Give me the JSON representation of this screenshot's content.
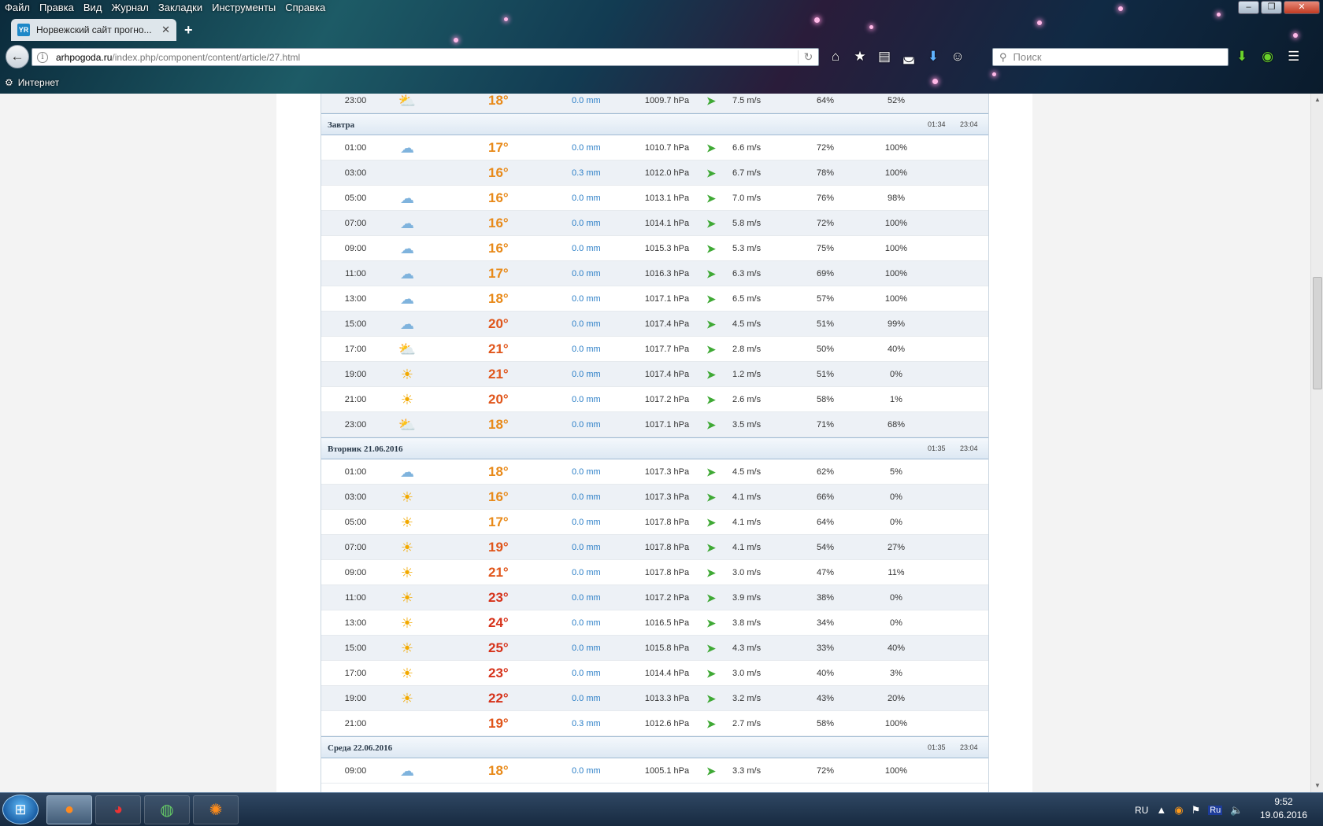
{
  "browser": {
    "menu": [
      "Файл",
      "Правка",
      "Вид",
      "Журнал",
      "Закладки",
      "Инструменты",
      "Справка"
    ],
    "tab_title": "Норвежский сайт прогно...",
    "tab_favicon": "YR",
    "url_host": "arhpogoda.ru",
    "url_path": "/index.php/component/content/article/27.html",
    "search_placeholder": "Поиск",
    "bookmark": "Интернет"
  },
  "forecast": {
    "partial_row": {
      "time": "23:00",
      "icon": "partly-cloudy-icon",
      "temp": "18°",
      "precip": "0.0 mm",
      "pressure": "1009.7 hPa",
      "wind": "7.5 m/s",
      "humidity": "64%",
      "cloud": "52%"
    },
    "days": [
      {
        "name": "Завтра",
        "sunrise": "01:34",
        "sunset": "23:04",
        "rows": [
          {
            "time": "01:00",
            "icon": "cloud-icon",
            "temp": "17°",
            "precip": "0.0 mm",
            "pressure": "1010.7 hPa",
            "wind": "6.6 m/s",
            "humidity": "72%",
            "cloud": "100%"
          },
          {
            "time": "03:00",
            "icon": "",
            "temp": "16°",
            "precip": "0.3 mm",
            "pressure": "1012.0 hPa",
            "wind": "6.7 m/s",
            "humidity": "78%",
            "cloud": "100%"
          },
          {
            "time": "05:00",
            "icon": "cloud-icon",
            "temp": "16°",
            "precip": "0.0 mm",
            "pressure": "1013.1 hPa",
            "wind": "7.0 m/s",
            "humidity": "76%",
            "cloud": "98%"
          },
          {
            "time": "07:00",
            "icon": "cloud-icon",
            "temp": "16°",
            "precip": "0.0 mm",
            "pressure": "1014.1 hPa",
            "wind": "5.8 m/s",
            "humidity": "72%",
            "cloud": "100%"
          },
          {
            "time": "09:00",
            "icon": "cloud-icon",
            "temp": "16°",
            "precip": "0.0 mm",
            "pressure": "1015.3 hPa",
            "wind": "5.3 m/s",
            "humidity": "75%",
            "cloud": "100%"
          },
          {
            "time": "11:00",
            "icon": "cloud-icon",
            "temp": "17°",
            "precip": "0.0 mm",
            "pressure": "1016.3 hPa",
            "wind": "6.3 m/s",
            "humidity": "69%",
            "cloud": "100%"
          },
          {
            "time": "13:00",
            "icon": "cloud-icon",
            "temp": "18°",
            "precip": "0.0 mm",
            "pressure": "1017.1 hPa",
            "wind": "6.5 m/s",
            "humidity": "57%",
            "cloud": "100%"
          },
          {
            "time": "15:00",
            "icon": "cloud-icon",
            "temp": "20°",
            "precip": "0.0 mm",
            "pressure": "1017.4 hPa",
            "wind": "4.5 m/s",
            "humidity": "51%",
            "cloud": "99%"
          },
          {
            "time": "17:00",
            "icon": "partly-cloudy-icon",
            "temp": "21°",
            "precip": "0.0 mm",
            "pressure": "1017.7 hPa",
            "wind": "2.8 m/s",
            "humidity": "50%",
            "cloud": "40%"
          },
          {
            "time": "19:00",
            "icon": "sun-icon",
            "temp": "21°",
            "precip": "0.0 mm",
            "pressure": "1017.4 hPa",
            "wind": "1.2 m/s",
            "humidity": "51%",
            "cloud": "0%"
          },
          {
            "time": "21:00",
            "icon": "sun-cloud-icon",
            "temp": "20°",
            "precip": "0.0 mm",
            "pressure": "1017.2 hPa",
            "wind": "2.6 m/s",
            "humidity": "58%",
            "cloud": "1%"
          },
          {
            "time": "23:00",
            "icon": "partly-cloudy-icon",
            "temp": "18°",
            "precip": "0.0 mm",
            "pressure": "1017.1 hPa",
            "wind": "3.5 m/s",
            "humidity": "71%",
            "cloud": "68%"
          }
        ]
      },
      {
        "name": "Вторник 21.06.2016",
        "sunrise": "01:35",
        "sunset": "23:04",
        "rows": [
          {
            "time": "01:00",
            "icon": "moon-cloud-icon",
            "temp": "18°",
            "precip": "0.0 mm",
            "pressure": "1017.3 hPa",
            "wind": "4.5 m/s",
            "humidity": "62%",
            "cloud": "5%"
          },
          {
            "time": "03:00",
            "icon": "sun-icon",
            "temp": "16°",
            "precip": "0.0 mm",
            "pressure": "1017.3 hPa",
            "wind": "4.1 m/s",
            "humidity": "66%",
            "cloud": "0%"
          },
          {
            "time": "05:00",
            "icon": "sun-icon",
            "temp": "17°",
            "precip": "0.0 mm",
            "pressure": "1017.8 hPa",
            "wind": "4.1 m/s",
            "humidity": "64%",
            "cloud": "0%"
          },
          {
            "time": "07:00",
            "icon": "sun-cloud-icon",
            "temp": "19°",
            "precip": "0.0 mm",
            "pressure": "1017.8 hPa",
            "wind": "4.1 m/s",
            "humidity": "54%",
            "cloud": "27%"
          },
          {
            "time": "09:00",
            "icon": "sun-icon",
            "temp": "21°",
            "precip": "0.0 mm",
            "pressure": "1017.8 hPa",
            "wind": "3.0 m/s",
            "humidity": "47%",
            "cloud": "11%"
          },
          {
            "time": "11:00",
            "icon": "sun-icon",
            "temp": "23°",
            "precip": "0.0 mm",
            "pressure": "1017.2 hPa",
            "wind": "3.9 m/s",
            "humidity": "38%",
            "cloud": "0%"
          },
          {
            "time": "13:00",
            "icon": "sun-icon",
            "temp": "24°",
            "precip": "0.0 mm",
            "pressure": "1016.5 hPa",
            "wind": "3.8 m/s",
            "humidity": "34%",
            "cloud": "0%"
          },
          {
            "time": "15:00",
            "icon": "sun-cloud-icon",
            "temp": "25°",
            "precip": "0.0 mm",
            "pressure": "1015.8 hPa",
            "wind": "4.3 m/s",
            "humidity": "33%",
            "cloud": "40%"
          },
          {
            "time": "17:00",
            "icon": "sun-icon",
            "temp": "23°",
            "precip": "0.0 mm",
            "pressure": "1014.4 hPa",
            "wind": "3.0 m/s",
            "humidity": "40%",
            "cloud": "3%"
          },
          {
            "time": "19:00",
            "icon": "sun-icon",
            "temp": "22°",
            "precip": "0.0 mm",
            "pressure": "1013.3 hPa",
            "wind": "3.2 m/s",
            "humidity": "43%",
            "cloud": "20%"
          },
          {
            "time": "21:00",
            "icon": "",
            "temp": "19°",
            "precip": "0.3 mm",
            "pressure": "1012.6 hPa",
            "wind": "2.7 m/s",
            "humidity": "58%",
            "cloud": "100%"
          }
        ]
      },
      {
        "name": "Среда 22.06.2016",
        "sunrise": "01:35",
        "sunset": "23:04",
        "rows": [
          {
            "time": "09:00",
            "icon": "cloud-icon",
            "temp": "18°",
            "precip": "0.0 mm",
            "pressure": "1005.1 hPa",
            "wind": "3.3 m/s",
            "humidity": "72%",
            "cloud": "100%"
          }
        ]
      }
    ]
  },
  "taskbar": {
    "apps": [
      "firefox-icon",
      "chrome-icon",
      "globe-app-icon",
      "wheel-app-icon"
    ],
    "lang": "RU",
    "layout_indicator": "Ru",
    "time": "9:52",
    "date": "19.06.2016"
  },
  "colors": {
    "temp_warm": "#e88a1a",
    "temp_hot": "#d6321a",
    "precip": "#2c7fc7",
    "wind_arrow": "#3fa935",
    "row_alt": "#edf1f6"
  }
}
